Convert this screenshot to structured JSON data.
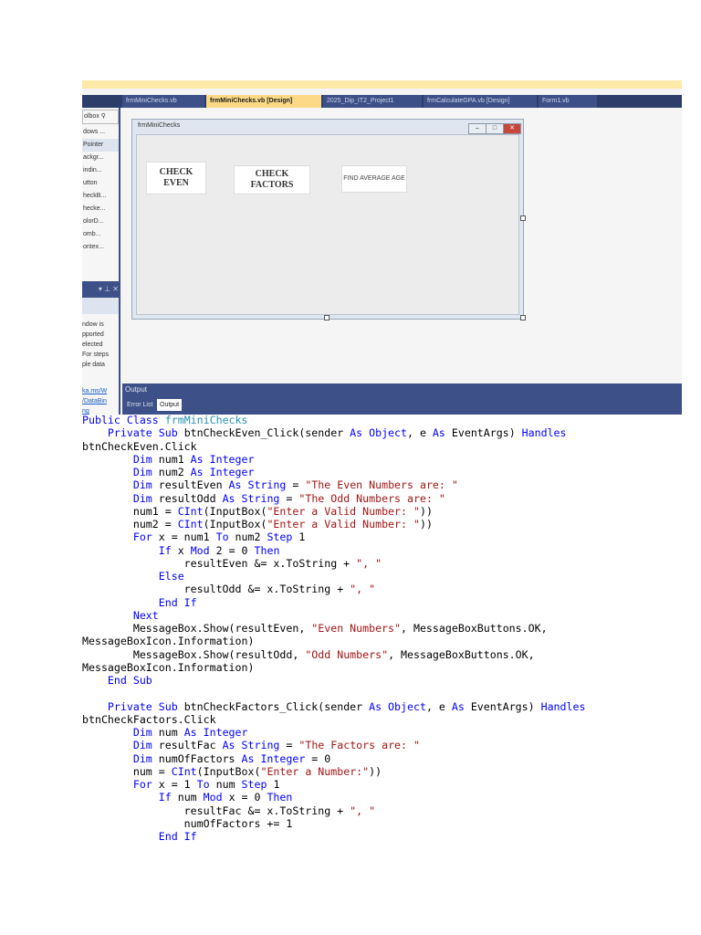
{
  "ide": {
    "tabs": [
      {
        "label": "frmMiniChecks.vb",
        "active": false
      },
      {
        "label": "frmMiniChecks.vb [Design]",
        "active": true
      },
      {
        "label": "2025_Dip_IT2_Project1",
        "active": false
      },
      {
        "label": "frmCalculateGPA.vb [Design]",
        "active": false
      },
      {
        "label": "Form1.vb",
        "active": false
      }
    ],
    "toolbox_search": "olbox",
    "toolbox_items": [
      "dows ...",
      "Pointer",
      "ackgr...",
      "indin...",
      "utton",
      "heckB...",
      "hecke...",
      "olorD...",
      "omb...",
      "ontex..."
    ],
    "panel_text": [
      "ndow is",
      "pported",
      "elected",
      "For steps",
      "ple data"
    ],
    "panel_links": [
      "ka.ms/W",
      "/DataBin",
      "ng"
    ],
    "form": {
      "title": "frmMiniChecks",
      "buttons": [
        "CHECK EVEN",
        "CHECK FACTORS",
        "FIND AVERAGE AGE"
      ]
    },
    "output_title": "Output",
    "output_tabs": [
      "Error List",
      "Output"
    ]
  },
  "colors": {
    "keyword": "#0000ff",
    "string": "#a31515",
    "class": "#2b91af",
    "ide_blue": "#3d5088",
    "active_tab": "#fbd986"
  },
  "code_lines": [
    [
      [
        "kw",
        "Public Class "
      ],
      [
        "cls",
        "frmMiniChecks"
      ]
    ],
    [
      [
        "",
        "    "
      ],
      [
        "kw",
        "Private Sub "
      ],
      [
        "",
        "btnCheckEven_Click(sender "
      ],
      [
        "kw",
        "As Object"
      ],
      [
        "",
        ", e "
      ],
      [
        "kw",
        "As "
      ],
      [
        "",
        "EventArgs) "
      ],
      [
        "kw",
        "Handles"
      ]
    ],
    [
      [
        "",
        "btnCheckEven.Click"
      ]
    ],
    [
      [
        "",
        "        "
      ],
      [
        "kw",
        "Dim "
      ],
      [
        "",
        "num1 "
      ],
      [
        "kw",
        "As Integer"
      ]
    ],
    [
      [
        "",
        "        "
      ],
      [
        "kw",
        "Dim "
      ],
      [
        "",
        "num2 "
      ],
      [
        "kw",
        "As Integer"
      ]
    ],
    [
      [
        "",
        "        "
      ],
      [
        "kw",
        "Dim "
      ],
      [
        "",
        "resultEven "
      ],
      [
        "kw",
        "As String"
      ],
      [
        "",
        " = "
      ],
      [
        "str",
        "\"The Even Numbers are: \""
      ]
    ],
    [
      [
        "",
        "        "
      ],
      [
        "kw",
        "Dim "
      ],
      [
        "",
        "resultOdd "
      ],
      [
        "kw",
        "As String"
      ],
      [
        "",
        " = "
      ],
      [
        "str",
        "\"The Odd Numbers are: \""
      ]
    ],
    [
      [
        "",
        "        num1 = "
      ],
      [
        "kw",
        "CInt"
      ],
      [
        "",
        "(InputBox("
      ],
      [
        "str",
        "\"Enter a Valid Number: \""
      ],
      [
        "",
        "))"
      ]
    ],
    [
      [
        "",
        "        num2 = "
      ],
      [
        "kw",
        "CInt"
      ],
      [
        "",
        "(InputBox("
      ],
      [
        "str",
        "\"Enter a Valid Number: \""
      ],
      [
        "",
        "))"
      ]
    ],
    [
      [
        "",
        "        "
      ],
      [
        "kw",
        "For "
      ],
      [
        "",
        "x = num1 "
      ],
      [
        "kw",
        "To "
      ],
      [
        "",
        "num2 "
      ],
      [
        "kw",
        "Step "
      ],
      [
        "",
        "1"
      ]
    ],
    [
      [
        "",
        "            "
      ],
      [
        "kw",
        "If "
      ],
      [
        "",
        "x "
      ],
      [
        "kw",
        "Mod "
      ],
      [
        "",
        "2 = 0 "
      ],
      [
        "kw",
        "Then"
      ]
    ],
    [
      [
        "",
        "                resultEven &= x.ToString + "
      ],
      [
        "str",
        "\", \""
      ]
    ],
    [
      [
        "",
        "            "
      ],
      [
        "kw",
        "Else"
      ]
    ],
    [
      [
        "",
        "                resultOdd &= x.ToString + "
      ],
      [
        "str",
        "\", \""
      ]
    ],
    [
      [
        "",
        "            "
      ],
      [
        "kw",
        "End If"
      ]
    ],
    [
      [
        "",
        "        "
      ],
      [
        "kw",
        "Next"
      ]
    ],
    [
      [
        "",
        "        MessageBox.Show(resultEven, "
      ],
      [
        "str",
        "\"Even Numbers\""
      ],
      [
        "",
        ", MessageBoxButtons.OK,"
      ]
    ],
    [
      [
        "",
        "MessageBoxIcon.Information)"
      ]
    ],
    [
      [
        "",
        "        MessageBox.Show(resultOdd, "
      ],
      [
        "str",
        "\"Odd Numbers\""
      ],
      [
        "",
        ", MessageBoxButtons.OK,"
      ]
    ],
    [
      [
        "",
        "MessageBoxIcon.Information)"
      ]
    ],
    [
      [
        "",
        "    "
      ],
      [
        "kw",
        "End Sub"
      ]
    ],
    [
      [
        "",
        ""
      ]
    ],
    [
      [
        "",
        "    "
      ],
      [
        "kw",
        "Private Sub "
      ],
      [
        "",
        "btnCheckFactors_Click(sender "
      ],
      [
        "kw",
        "As Object"
      ],
      [
        "",
        ", e "
      ],
      [
        "kw",
        "As "
      ],
      [
        "",
        "EventArgs) "
      ],
      [
        "kw",
        "Handles"
      ]
    ],
    [
      [
        "",
        "btnCheckFactors.Click"
      ]
    ],
    [
      [
        "",
        "        "
      ],
      [
        "kw",
        "Dim "
      ],
      [
        "",
        "num "
      ],
      [
        "kw",
        "As Integer"
      ]
    ],
    [
      [
        "",
        "        "
      ],
      [
        "kw",
        "Dim "
      ],
      [
        "",
        "resultFac "
      ],
      [
        "kw",
        "As String"
      ],
      [
        "",
        " = "
      ],
      [
        "str",
        "\"The Factors are: \""
      ]
    ],
    [
      [
        "",
        "        "
      ],
      [
        "kw",
        "Dim "
      ],
      [
        "",
        "numOfFactors "
      ],
      [
        "kw",
        "As Integer"
      ],
      [
        "",
        " = 0"
      ]
    ],
    [
      [
        "",
        "        num = "
      ],
      [
        "kw",
        "CInt"
      ],
      [
        "",
        "(InputBox("
      ],
      [
        "str",
        "\"Enter a Number:\""
      ],
      [
        "",
        "))"
      ]
    ],
    [
      [
        "",
        "        "
      ],
      [
        "kw",
        "For "
      ],
      [
        "",
        "x = 1 "
      ],
      [
        "kw",
        "To "
      ],
      [
        "",
        "num "
      ],
      [
        "kw",
        "Step "
      ],
      [
        "",
        "1"
      ]
    ],
    [
      [
        "",
        "            "
      ],
      [
        "kw",
        "If "
      ],
      [
        "",
        "num "
      ],
      [
        "kw",
        "Mod "
      ],
      [
        "",
        "x = 0 "
      ],
      [
        "kw",
        "Then"
      ]
    ],
    [
      [
        "",
        "                resultFac &= x.ToString + "
      ],
      [
        "str",
        "\", \""
      ]
    ],
    [
      [
        "",
        "                numOfFactors += 1"
      ]
    ],
    [
      [
        "",
        "            "
      ],
      [
        "kw",
        "End If"
      ]
    ]
  ]
}
